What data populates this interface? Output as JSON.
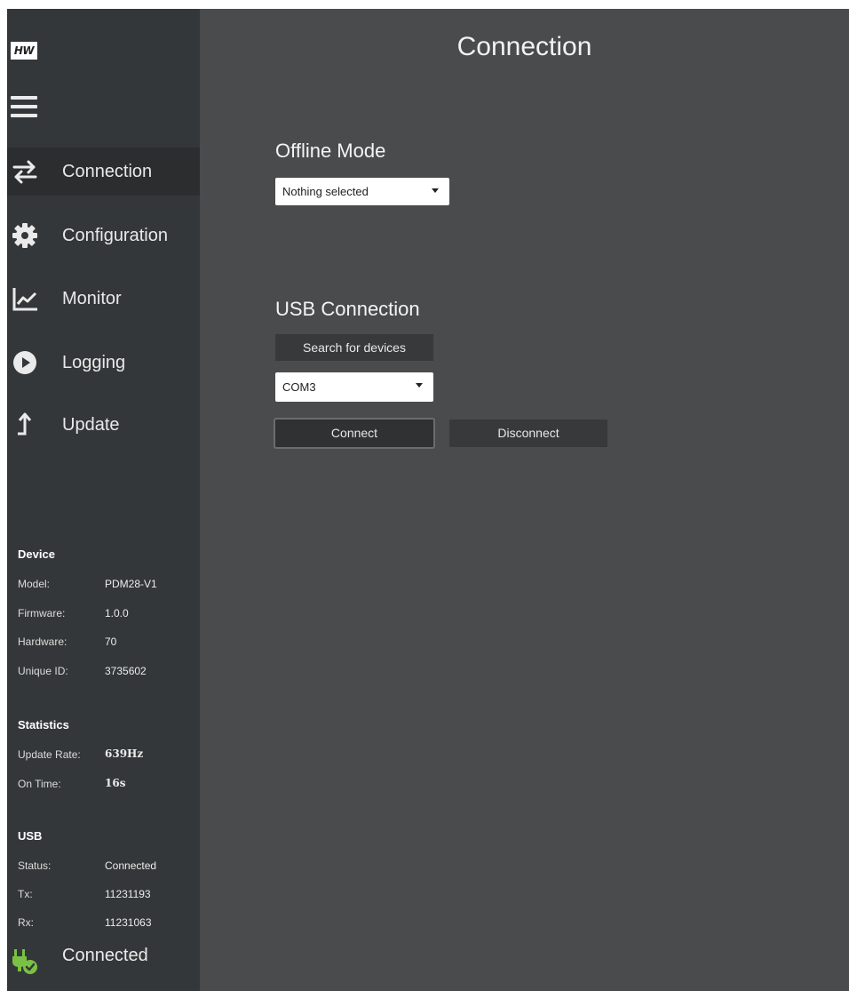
{
  "logo_text": "HW",
  "nav": [
    {
      "label": "Connection",
      "icon": "arrows-swap-icon",
      "active": true
    },
    {
      "label": "Configuration",
      "icon": "gear-icon",
      "active": false
    },
    {
      "label": "Monitor",
      "icon": "line-chart-icon",
      "active": false
    },
    {
      "label": "Logging",
      "icon": "play-icon",
      "active": false
    },
    {
      "label": "Update",
      "icon": "upload-arrow-icon",
      "active": false
    }
  ],
  "device": {
    "title": "Device",
    "model_label": "Model:",
    "model_value": "PDM28-V1",
    "firmware_label": "Firmware:",
    "firmware_value": "1.0.0",
    "hardware_label": "Hardware:",
    "hardware_value": "70",
    "uid_label": "Unique ID:",
    "uid_value": "3735602"
  },
  "statistics": {
    "title": "Statistics",
    "rate_label": "Update Rate:",
    "rate_value": "639Hz",
    "ontime_label": "On Time:",
    "ontime_value": "16s"
  },
  "usb": {
    "title": "USB",
    "status_label": "Status:",
    "status_value": "Connected",
    "tx_label": "Tx:",
    "tx_value": "11231193",
    "rx_label": "Rx:",
    "rx_value": "11231063"
  },
  "footer": {
    "status": "Connected",
    "icon": "plug-connected-icon",
    "icon_color": "#7ac143"
  },
  "main": {
    "title": "Connection",
    "offline": {
      "title": "Offline Mode",
      "select_value": "Nothing selected"
    },
    "usb_connection": {
      "title": "USB Connection",
      "search_label": "Search for devices",
      "port_value": "COM3",
      "connect_label": "Connect",
      "disconnect_label": "Disconnect"
    }
  },
  "colors": {
    "sidebar_bg": "#343739",
    "main_bg": "#4a4b4d",
    "active_nav_bg": "#2b2d2f",
    "accent_green": "#7ac143"
  }
}
